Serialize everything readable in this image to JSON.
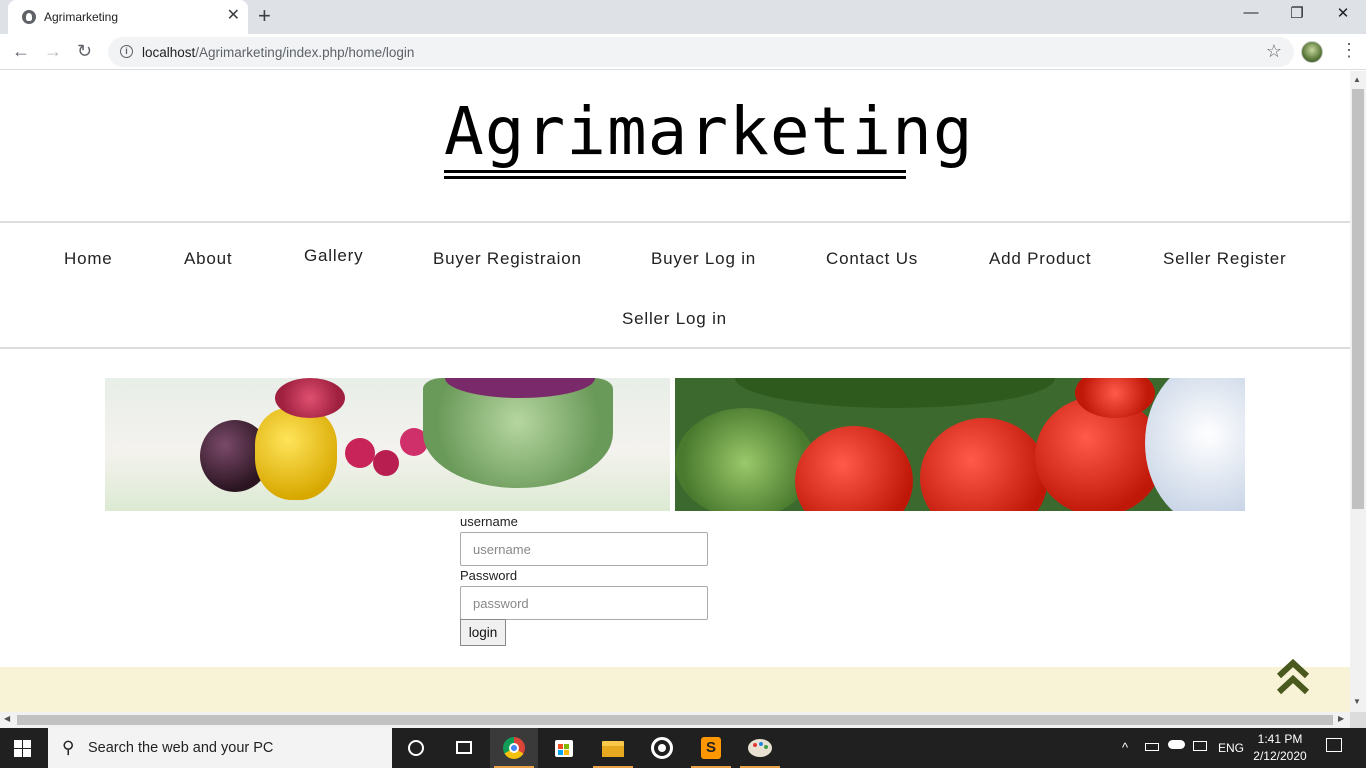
{
  "browser": {
    "tab_title": "Agrimarketing",
    "url_host": "localhost",
    "url_path": "/Agrimarketing/index.php/home/login"
  },
  "site": {
    "brand": "Agrimarketing",
    "nav": [
      "Home",
      "About",
      "Gallery",
      "Buyer Registraion",
      "Buyer Log in",
      "Contact Us",
      "Add Product",
      "Seller Register",
      "Seller Log in"
    ]
  },
  "login_form": {
    "username_label": "username",
    "username_placeholder": "username",
    "password_label": "Password",
    "password_placeholder": "password",
    "submit_label": "login"
  },
  "taskbar": {
    "search_placeholder": "Search the web and your PC",
    "language": "ENG",
    "time": "1:41 PM",
    "date": "2/12/2020"
  },
  "colors": {
    "footer_bg": "#f8f2d6",
    "accent_green": "#4a5a1e"
  }
}
